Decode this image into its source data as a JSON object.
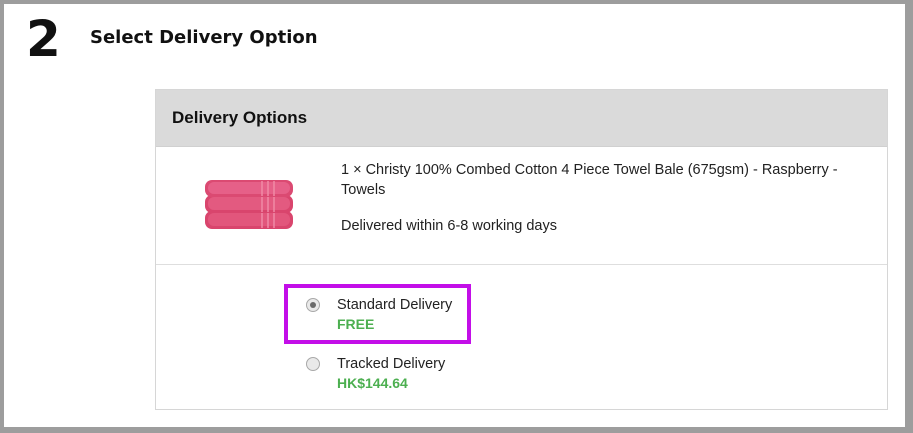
{
  "step": {
    "number": "2",
    "title": "Select Delivery Option"
  },
  "panel": {
    "header": "Delivery Options",
    "product": {
      "description": "1 × Christy 100% Combed Cotton 4 Piece Towel Bale (675gsm) - Raspberry - Towels",
      "delivery_time": "Delivered within 6-8 working days",
      "image_color": "#e2567c"
    },
    "options": [
      {
        "label": "Standard Delivery",
        "price": "FREE",
        "selected": true
      },
      {
        "label": "Tracked Delivery",
        "price": "HK$144.64",
        "selected": false
      }
    ]
  },
  "colors": {
    "price_green": "#4caf50",
    "highlight": "#c30ee8",
    "header_bg": "#dadada"
  }
}
